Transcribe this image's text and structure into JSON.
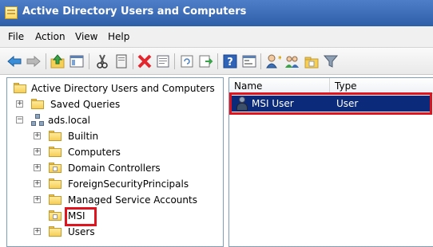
{
  "window": {
    "title": "Active Directory Users and Computers"
  },
  "menu": {
    "items": [
      "File",
      "Action",
      "View",
      "Help"
    ]
  },
  "toolbar": {
    "buttons": [
      "back-arrow-icon",
      "forward-arrow-icon",
      "up-folder-icon",
      "show-tree-icon",
      "cut-icon",
      "copy-icon",
      "delete-icon",
      "properties-icon",
      "refresh-icon",
      "export-list-icon",
      "help-icon",
      "console-icon",
      "new-user-icon",
      "new-group-icon",
      "new-ou-icon",
      "filter-icon"
    ]
  },
  "tree": {
    "root": "Active Directory Users and Computers",
    "items": [
      {
        "label": "Saved Queries"
      },
      {
        "label": "ads.local"
      },
      {
        "label": "Builtin"
      },
      {
        "label": "Computers"
      },
      {
        "label": "Domain Controllers"
      },
      {
        "label": "ForeignSecurityPrincipals"
      },
      {
        "label": "Managed Service Accounts"
      },
      {
        "label": "MSI"
      },
      {
        "label": "Users"
      }
    ],
    "expander_plus": "+",
    "expander_minus": "−"
  },
  "list": {
    "columns": [
      "Name",
      "Type"
    ],
    "rows": [
      {
        "name": "MSI User",
        "type": "User"
      }
    ]
  },
  "colors": {
    "title_bar": "#2d5ea8",
    "selection": "#0b2b7a",
    "highlight_box": "#e0141e"
  }
}
